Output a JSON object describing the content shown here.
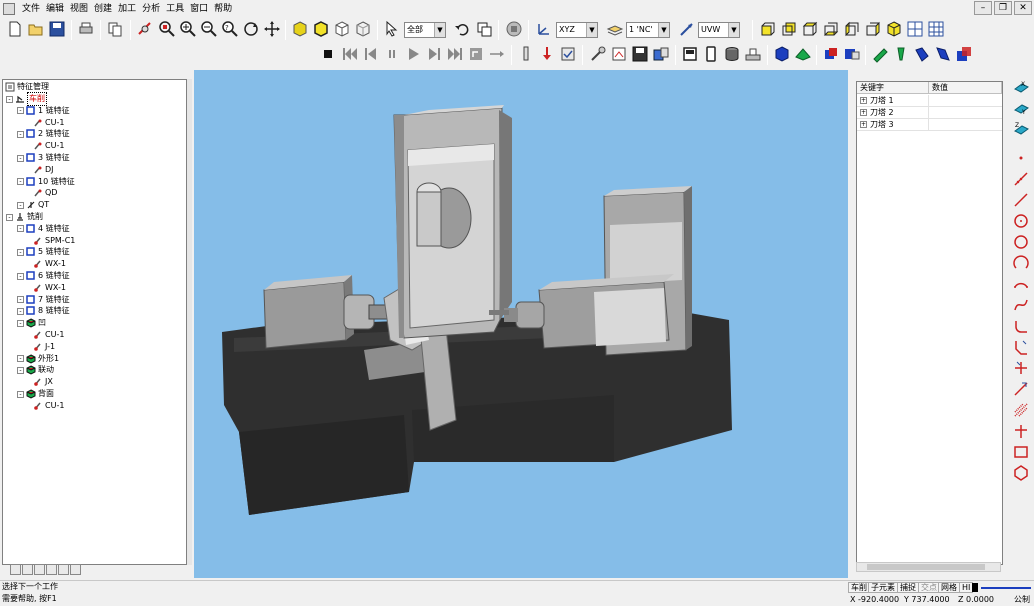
{
  "menu": [
    "文件",
    "编辑",
    "视图",
    "创建",
    "加工",
    "分析",
    "工具",
    "窗口",
    "帮助"
  ],
  "toolbar": {
    "filter_select": "全部",
    "plane_select": "XYZ",
    "layer_select": "1 'NC'",
    "uvw_select": "UVW"
  },
  "tree": {
    "title": "特征管理",
    "items": [
      {
        "label": "车削",
        "level": 0,
        "icon": "turning-icon",
        "selected": true
      },
      {
        "label": "1 链特征",
        "level": 1,
        "icon": "chain-icon"
      },
      {
        "label": "CU-1",
        "level": 2,
        "icon": "tool-op-icon"
      },
      {
        "label": "2 链特征",
        "level": 1,
        "icon": "chain-icon"
      },
      {
        "label": "CU-1",
        "level": 2,
        "icon": "tool-op-icon"
      },
      {
        "label": "3 链特征",
        "level": 1,
        "icon": "chain-icon"
      },
      {
        "label": "DJ",
        "level": 2,
        "icon": "tool-op-icon"
      },
      {
        "label": "10 链特征",
        "level": 1,
        "icon": "chain-icon"
      },
      {
        "label": "QD",
        "level": 2,
        "icon": "tool-op-icon"
      },
      {
        "label": "QT",
        "level": 1,
        "icon": "cutoff-icon"
      },
      {
        "label": "铣削",
        "level": 0,
        "icon": "milling-icon"
      },
      {
        "label": "4 链特征",
        "level": 1,
        "icon": "chain-icon"
      },
      {
        "label": "SPM-C1",
        "level": 2,
        "icon": "mill-op-icon"
      },
      {
        "label": "5 链特征",
        "level": 1,
        "icon": "chain-icon"
      },
      {
        "label": "WX-1",
        "level": 2,
        "icon": "mill-op-icon"
      },
      {
        "label": "6 链特征",
        "level": 1,
        "icon": "chain-icon"
      },
      {
        "label": "WX-1",
        "level": 2,
        "icon": "mill-op-icon"
      },
      {
        "label": "7 链特征",
        "level": 1,
        "icon": "chain-icon"
      },
      {
        "label": "8 链特征",
        "level": 1,
        "icon": "chain-icon"
      },
      {
        "label": "凹",
        "level": 1,
        "icon": "solid-feature-icon"
      },
      {
        "label": "CU-1",
        "level": 2,
        "icon": "mill-op-icon"
      },
      {
        "label": "J-1",
        "level": 2,
        "icon": "mill-op-icon"
      },
      {
        "label": "外形1",
        "level": 1,
        "icon": "solid-feature-icon"
      },
      {
        "label": "联动",
        "level": 1,
        "icon": "solid-feature-icon"
      },
      {
        "label": "JX",
        "level": 2,
        "icon": "mill-op-icon"
      },
      {
        "label": "背面",
        "level": 1,
        "icon": "solid-feature-icon"
      },
      {
        "label": "CU-1",
        "level": 2,
        "icon": "mill-op-icon"
      }
    ]
  },
  "properties": {
    "headers": [
      "关键字",
      "数值"
    ],
    "rows": [
      {
        "key": "刀塔 1",
        "value": ""
      },
      {
        "key": "刀塔 2",
        "value": ""
      },
      {
        "key": "刀塔 3",
        "value": ""
      }
    ]
  },
  "status": {
    "prompt": "选择下一个工作",
    "help": "需要帮助, 按F1",
    "buttons": [
      "车削",
      "子元素",
      "捕捉",
      "交点",
      "网格",
      "HI"
    ],
    "x": "X -920.4000",
    "y": "Y 737.4000",
    "z": "Z 0.0000",
    "unit": "公制"
  },
  "colors": {
    "viewport_bg": "#85bde8",
    "machine_dark": "#2e2e2e",
    "machine_gray": "#9a9a9a",
    "machine_light": "#cfcfcf"
  }
}
